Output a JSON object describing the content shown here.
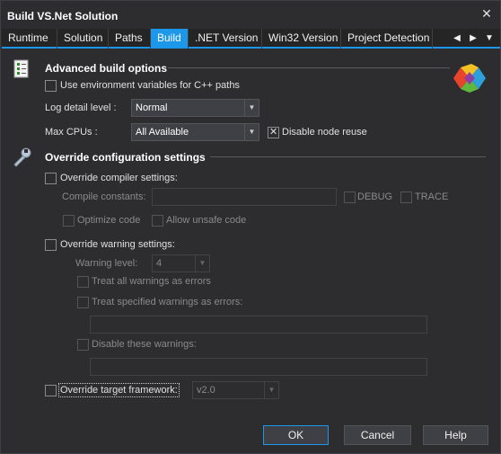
{
  "window": {
    "title": "Build VS.Net Solution",
    "close_glyph": "✕"
  },
  "tabs": [
    {
      "label": "Runtime"
    },
    {
      "label": "Solution"
    },
    {
      "label": "Paths"
    },
    {
      "label": "Build"
    },
    {
      "label": ".NET Version"
    },
    {
      "label": "Win32 Version"
    },
    {
      "label": "Project Detection"
    }
  ],
  "tab_nav": {
    "prev": "◀",
    "next": "▶",
    "menu": "▼"
  },
  "advanced": {
    "title": "Advanced build options",
    "use_env_vars": {
      "label": "Use environment variables for C++ paths",
      "checked": false
    },
    "log_detail": {
      "label": "Log detail level :",
      "value": "Normal"
    },
    "max_cpus": {
      "label": "Max CPUs :",
      "value": "All Available"
    },
    "disable_node_reuse": {
      "label": "Disable node reuse",
      "checked": true
    }
  },
  "override": {
    "title": "Override configuration settings",
    "compiler": {
      "label": "Override compiler settings:",
      "compile_constants_label": "Compile constants:",
      "debug_label": "DEBUG",
      "trace_label": "TRACE",
      "optimize_label": "Optimize code",
      "unsafe_label": "Allow unsafe code"
    },
    "warnings": {
      "label": "Override warning settings:",
      "level_label": "Warning level:",
      "level_value": "4",
      "treat_all_label": "Treat all warnings as errors",
      "treat_specified_label": "Treat specified warnings as errors:",
      "disable_label": "Disable these warnings:"
    },
    "framework": {
      "label": "Override target framework:",
      "value": "v2.0"
    }
  },
  "buttons": {
    "ok": "OK",
    "cancel": "Cancel",
    "help": "Help"
  },
  "colors": {
    "accent": "#1c97ea",
    "background": "#2d2d30"
  }
}
